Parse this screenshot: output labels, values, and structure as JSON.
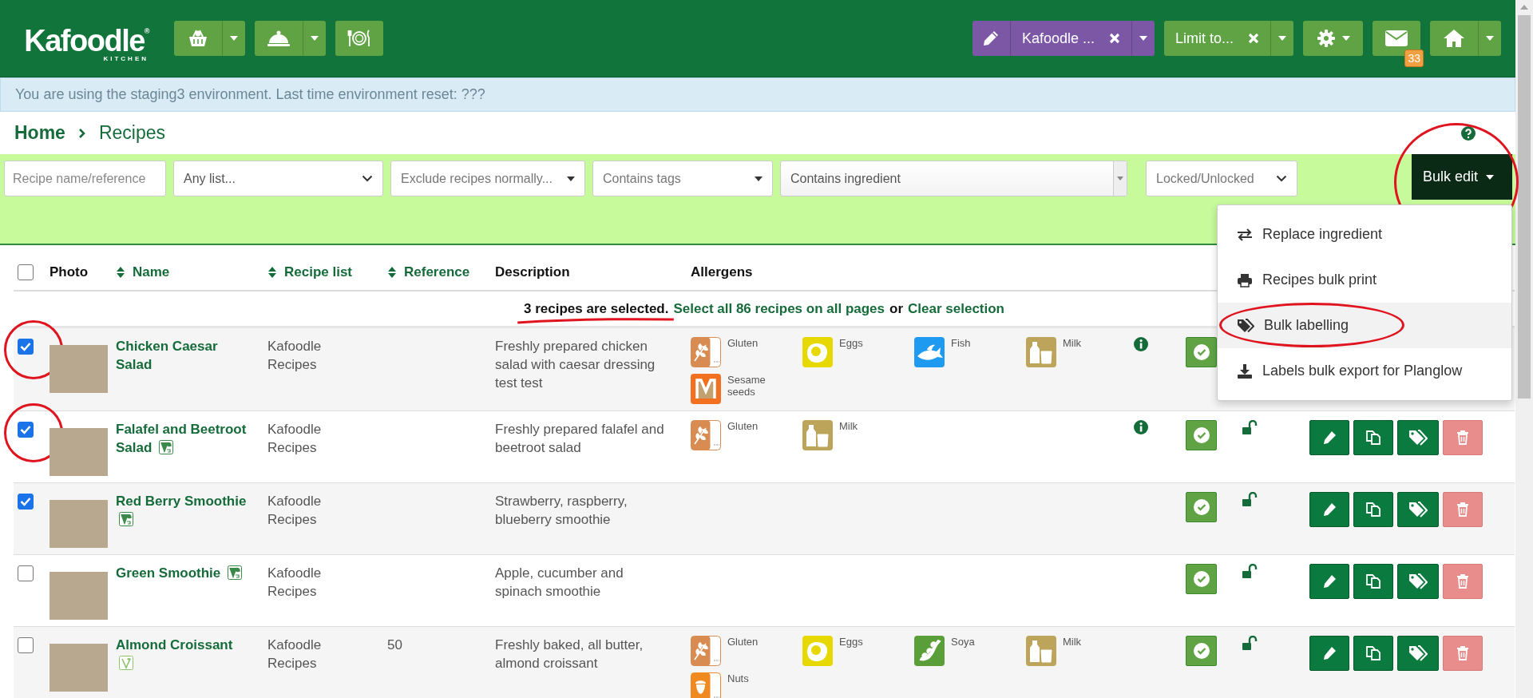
{
  "header": {
    "logo": {
      "name": "Kafoodle$^{®}$",
      "sub": "KITCHEN"
    },
    "left_buttons": [
      {
        "kind": "basket",
        "caret": true
      },
      {
        "kind": "cloche",
        "caret": true
      },
      {
        "kind": "plate",
        "caret": false
      }
    ],
    "site_selector": {
      "label": "Kafoodle ..."
    },
    "limit_selector": {
      "label": "Limit to..."
    },
    "settings": {
      "caret": true
    },
    "mail": {
      "badge": "33"
    },
    "home": {
      "caret": true
    }
  },
  "environment_notice": "You are using the staging3 environment. Last time environment reset: ???",
  "breadcrumb": {
    "home": "Home",
    "current": "Recipes"
  },
  "filters": [
    {
      "kind": "input",
      "placeholder": "Recipe name/reference"
    },
    {
      "kind": "select",
      "label": "Any list..."
    },
    {
      "kind": "dropdown",
      "label": "Exclude recipes normally..."
    },
    {
      "kind": "dropdown",
      "label": "Contains tags"
    },
    {
      "kind": "combobox",
      "label": "Contains ingredient"
    },
    {
      "kind": "select",
      "label": "Locked/Unlocked"
    }
  ],
  "bulk_edit": {
    "label": "Bulk edit",
    "circled": true,
    "expanded": true,
    "menu": [
      {
        "kind": "replace",
        "label": "Replace ingredient",
        "hovered": false,
        "circled": false
      },
      {
        "kind": "print",
        "label": "Recipes bulk print",
        "hovered": false,
        "circled": false
      },
      {
        "kind": "tag",
        "label": "Bulk labelling",
        "hovered": true,
        "circled": true
      },
      {
        "kind": "download",
        "label": "Labels bulk export for Planglow",
        "hovered": false,
        "circled": false
      }
    ]
  },
  "table": {
    "all_checked": false,
    "columns": [
      {
        "label": "Photo",
        "sortable": false
      },
      {
        "label": "Name",
        "sortable": true
      },
      {
        "label": "Recipe list",
        "sortable": true
      },
      {
        "label": "Reference",
        "sortable": true
      },
      {
        "label": "Description",
        "sortable": false
      },
      {
        "label": "Allergens",
        "sortable": false
      }
    ],
    "selection": {
      "summary": "3 recipes are selected.",
      "underlined": true,
      "select_all": "Select all 86 recipes on all pages",
      "or": "or",
      "clear": "Clear selection"
    },
    "rows": [
      {
        "checked": true,
        "circled": true,
        "name": "Chicken Caesar Salad",
        "recipe_list": "Kafoodle Recipes",
        "description": "Freshly prepared chicken salad with caesar dressing test test",
        "info": true,
        "allergens": [
          {
            "kind": "gluten",
            "name": "Gluten",
            "color": "#d98c52"
          },
          {
            "kind": "eggs",
            "name": "Eggs",
            "color": "#e6d800"
          },
          {
            "kind": "fish",
            "name": "Fish",
            "color": "#1e9bf0"
          },
          {
            "kind": "milk",
            "name": "Milk",
            "color": "#bca45a"
          },
          {
            "kind": "sesame",
            "name": "Sesame seeds",
            "color": "#f2701f"
          }
        ]
      },
      {
        "checked": true,
        "circled": true,
        "name": "Falafel and Beetroot Salad",
        "diet_badge": {
          "kind": "vegan"
        },
        "recipe_list": "Kafoodle Recipes",
        "description": "Freshly prepared falafel and beetroot salad",
        "info": true,
        "allergens": [
          {
            "kind": "gluten",
            "name": "Gluten",
            "color": "#d98c52"
          },
          {
            "kind": "milk",
            "name": "Milk",
            "color": "#bca45a"
          }
        ]
      },
      {
        "checked": true,
        "circled": false,
        "name": "Red Berry Smoothie",
        "diet_badge": {
          "kind": "vegan"
        },
        "recipe_list": "Kafoodle Recipes",
        "description": "Strawberry, raspberry, blueberry smoothie",
        "info": false,
        "allergens": []
      },
      {
        "checked": false,
        "circled": false,
        "name": "Green Smoothie",
        "diet_badge": {
          "kind": "vegan"
        },
        "recipe_list": "Kafoodle Recipes",
        "description": "Apple, cucumber and spinach smoothie",
        "info": false,
        "allergens": []
      },
      {
        "checked": false,
        "circled": false,
        "name": "Almond Croissant",
        "diet_badge": {
          "kind": "vegetarian"
        },
        "recipe_list": "Kafoodle Recipes",
        "reference": "50",
        "description": "Freshly baked, all butter, almond croissant",
        "info": false,
        "allergens": [
          {
            "kind": "gluten",
            "name": "Gluten",
            "color": "#d98c52"
          },
          {
            "kind": "eggs",
            "name": "Eggs",
            "color": "#e6d800"
          },
          {
            "kind": "soya",
            "name": "Soya",
            "color": "#5a9e3a"
          },
          {
            "kind": "milk",
            "name": "Milk",
            "color": "#bca45a"
          },
          {
            "kind": "nuts",
            "name": "Nuts",
            "color": "#f08a20"
          }
        ]
      }
    ]
  }
}
